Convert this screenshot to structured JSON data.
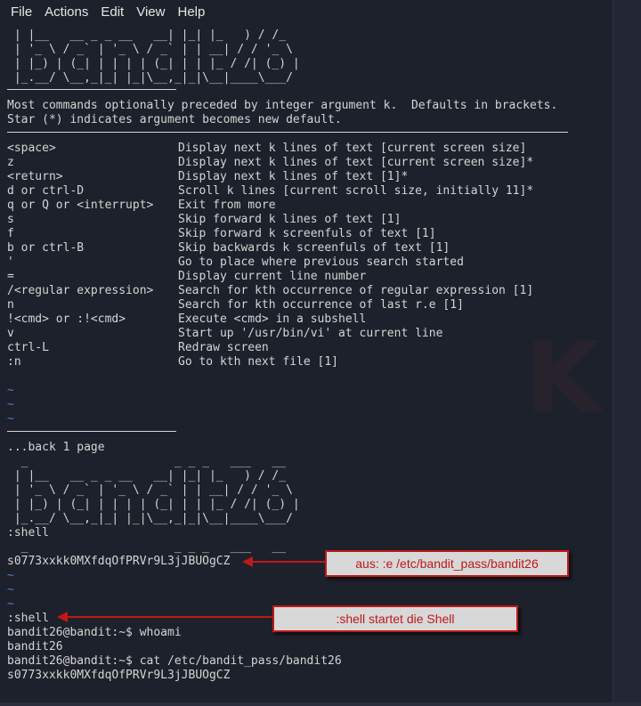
{
  "menubar": {
    "items": [
      "File",
      "Actions",
      "Edit",
      "View",
      "Help"
    ]
  },
  "terminal": {
    "banner_top": [
      " | |__   __ _ _ __   __| |_| |_   ) / /_",
      " | '_ \\ / _` | '_ \\ / _` | | __| / / '_ \\",
      " | |_) | (_| | | | | (_| | | |_ / /| (_) |",
      " |_.__/ \\__,_|_| |_|\\__,_|_|\\__|____\\___/"
    ],
    "intro": [
      "Most commands optionally preceded by integer argument k.  Defaults in brackets.",
      "Star (*) indicates argument becomes new default."
    ],
    "commands": [
      {
        "key": "<space>",
        "desc": "Display next k lines of text [current screen size]"
      },
      {
        "key": "z",
        "desc": "Display next k lines of text [current screen size]*"
      },
      {
        "key": "<return>",
        "desc": "Display next k lines of text [1]*"
      },
      {
        "key": "d or ctrl-D",
        "desc": "Scroll k lines [current scroll size, initially 11]*"
      },
      {
        "key": "q or Q or <interrupt>",
        "desc": "Exit from more"
      },
      {
        "key": "s",
        "desc": "Skip forward k lines of text [1]"
      },
      {
        "key": "f",
        "desc": "Skip forward k screenfuls of text [1]"
      },
      {
        "key": "b or ctrl-B",
        "desc": "Skip backwards k screenfuls of text [1]"
      },
      {
        "key": "'",
        "desc": "Go to place where previous search started"
      },
      {
        "key": "=",
        "desc": "Display current line number"
      },
      {
        "key": "/<regular expression>",
        "desc": "Search for kth occurrence of regular expression [1]"
      },
      {
        "key": "n",
        "desc": "Search for kth occurrence of last r.e [1]"
      },
      {
        "key": "!<cmd> or :!<cmd>",
        "desc": "Execute <cmd> in a subshell"
      },
      {
        "key": "v",
        "desc": "Start up '/usr/bin/vi' at current line"
      },
      {
        "key": "ctrl-L",
        "desc": "Redraw screen"
      },
      {
        "key": ":n",
        "desc": "Go to kth next file [1]"
      }
    ],
    "tilde": "~",
    "back_page": "...back 1 page",
    "banner_mid": [
      "  _                     _ _ _   ___   __",
      " | |__   __ _ _ __   __| |_| |_   ) / /_",
      " | '_ \\ / _` | '_ \\ / _` | | __| / / '_ \\",
      " | |_) | (_| | | | | (_| | | |_ / /| (_) |",
      " |_.__/ \\__,_|_| |_|\\__,_|_|\\__|____\\___/"
    ],
    "shell_cmd_1": ":shell",
    "banner_partial": "  _                     _ _ _   ___   __",
    "password_1": "s0773xxkk0MXfdqOfPRVr9L3jJBUOgCZ",
    "shell_cmd_2": ":shell",
    "session": [
      "bandit26@bandit:~$ whoami",
      "bandit26",
      "bandit26@bandit:~$ cat /etc/bandit_pass/bandit26",
      "s0773xxkk0MXfdqOfPRVr9L3jJBUOgCZ"
    ]
  },
  "annotations": {
    "note_1": "aus: :e /etc/bandit_pass/bandit26",
    "note_2": ":shell startet die Shell"
  },
  "colors": {
    "background": "#1d212b",
    "text": "#d4d4d4",
    "tilde": "#4a7fd6",
    "annotation_border": "#c01818",
    "annotation_fill": "#d8d8d8"
  }
}
